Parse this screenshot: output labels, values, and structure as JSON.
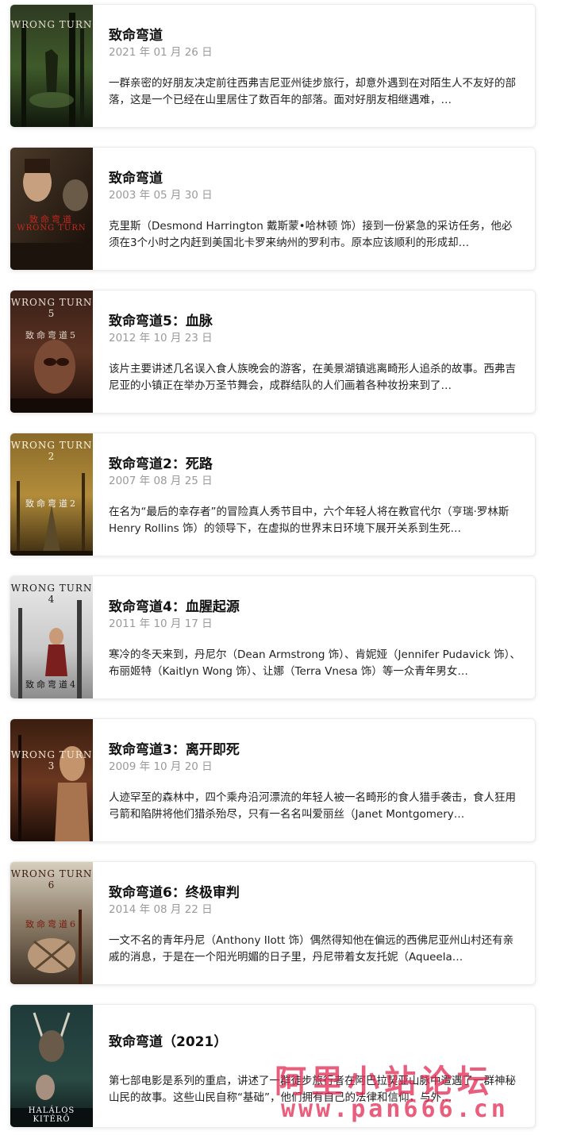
{
  "movies": [
    {
      "title": "致命弯道",
      "date": "2021 年 01 月 26 日",
      "desc": "一群亲密的好朋友决定前往西弗吉尼亚州徒步旅行，却意外遇到在对陌生人不友好的部落，这是一个已经在山里居住了数百年的部落。面对好朋友相继遇难，…",
      "poster_title": "WRONG TURN",
      "poster_cn": ""
    },
    {
      "title": "致命弯道",
      "date": "2003 年 05 月 30 日",
      "desc": "克里斯（Desmond Harrington 戴斯蒙•哈林顿 饰）接到一份紧急的采访任务，他必须在3个小时之内赶到美国北卡罗来纳州的罗利市。原本应该顺利的形成却…",
      "poster_title": "WRONG TURN",
      "poster_cn": "致命弯道"
    },
    {
      "title": "致命弯道5：血脉",
      "date": "2012 年 10 月 23 日",
      "desc": "该片主要讲述几名误入食人族晚会的游客，在美景湖镇逃离畸形人追杀的故事。西弗吉尼亚的小镇正在举办万圣节舞会，成群结队的人们画着各种妆扮来到了…",
      "poster_title": "WRONG TURN 5",
      "poster_cn": "致命弯道5"
    },
    {
      "title": "致命弯道2：死路",
      "date": "2007 年 08 月 25 日",
      "desc": "在名为“最后的幸存者”的冒险真人秀节目中，六个年轻人将在教官代尔（亨瑞·罗林斯 Henry Rollins 饰）的领导下，在虚拟的世界末日环境下展开关系到生死…",
      "poster_title": "WRONG TURN 2",
      "poster_cn": "致命弯道2"
    },
    {
      "title": "致命弯道4：血腥起源",
      "date": "2011 年 10 月 17 日",
      "desc": "寒冷的冬天来到，丹尼尔（Dean Armstrong 饰）、肯妮娅（Jennifer Pudavick 饰）、布丽姬特（Kaitlyn Wong 饰）、让娜（Terra Vnesa 饰）等一众青年男女…",
      "poster_title": "WRONG TURN 4",
      "poster_cn": "致命弯道4"
    },
    {
      "title": "致命弯道3：离开即死",
      "date": "2009 年 10 月 20 日",
      "desc": "人迹罕至的森林中，四个乘舟沿河漂流的年轻人被一名畸形的食人猎手袭击，食人狂用弓箭和陷阱将他们猎杀殆尽，只有一名名叫爱丽丝（Janet Montgomery…",
      "poster_title": "WRONG TURN 3",
      "poster_cn": ""
    },
    {
      "title": "致命弯道6：终极审判",
      "date": "2014 年 08 月 22 日",
      "desc": "一文不名的青年丹尼（Anthony Ilott 饰）偶然得知他在偏远的西佛尼亚州山村还有亲戚的消息，于是在一个阳光明媚的日子里，丹尼带着女友托妮（Aqueela…",
      "poster_title": "WRONG TURN 6",
      "poster_cn": "致命弯道6"
    },
    {
      "title": "致命弯道（2021）",
      "date": "",
      "desc": "第七部电影是系列的重启，讲述了一群徒步旅行者在阿巴拉契亚山脉中遭遇了一群神秘山民的故事。这些山民自称“基础”，他们拥有自己的法律和信仰，与外…",
      "poster_title": "HALÁLOS KITÉRŐ",
      "poster_cn": ""
    }
  ],
  "watermark": {
    "line1": "阿里小站论坛",
    "line2": "www.pan666.cn"
  },
  "colors": {
    "watermark": "#e22850",
    "date": "#9a9a9a"
  }
}
